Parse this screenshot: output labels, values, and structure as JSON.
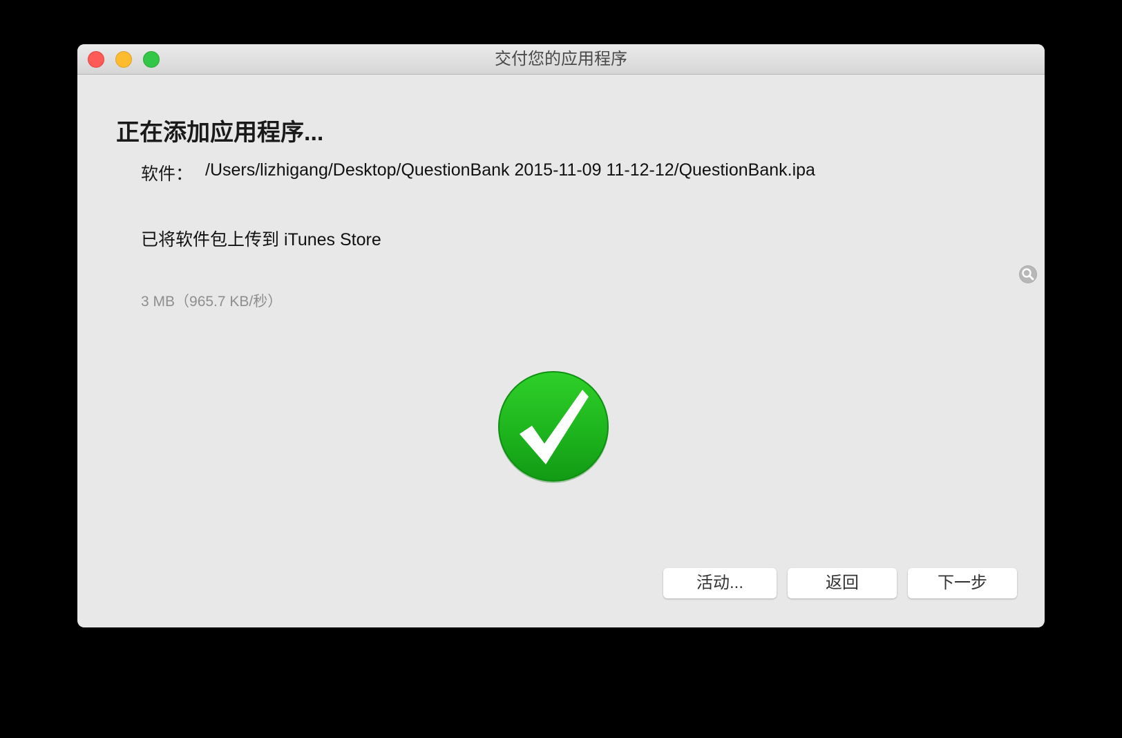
{
  "window": {
    "title": "交付您的应用程序"
  },
  "main": {
    "heading": "正在添加应用程序...",
    "software_label": "软件：",
    "software_path": "/Users/lizhigang/Desktop/QuestionBank 2015-11-09 11-12-12/QuestionBank.ipa",
    "status": "已将软件包上传到 iTunes Store",
    "transfer_info": "3 MB（965.7 KB/秒）"
  },
  "icons": {
    "success": "checkmark-circle-icon",
    "magnifier": "magnifier-icon"
  },
  "buttons": {
    "activity": "活动...",
    "back": "返回",
    "next": "下一步"
  },
  "colors": {
    "success_green": "#1db31f",
    "close": "#fc5b57",
    "minimize": "#fdbc2e",
    "zoom": "#33c748"
  }
}
